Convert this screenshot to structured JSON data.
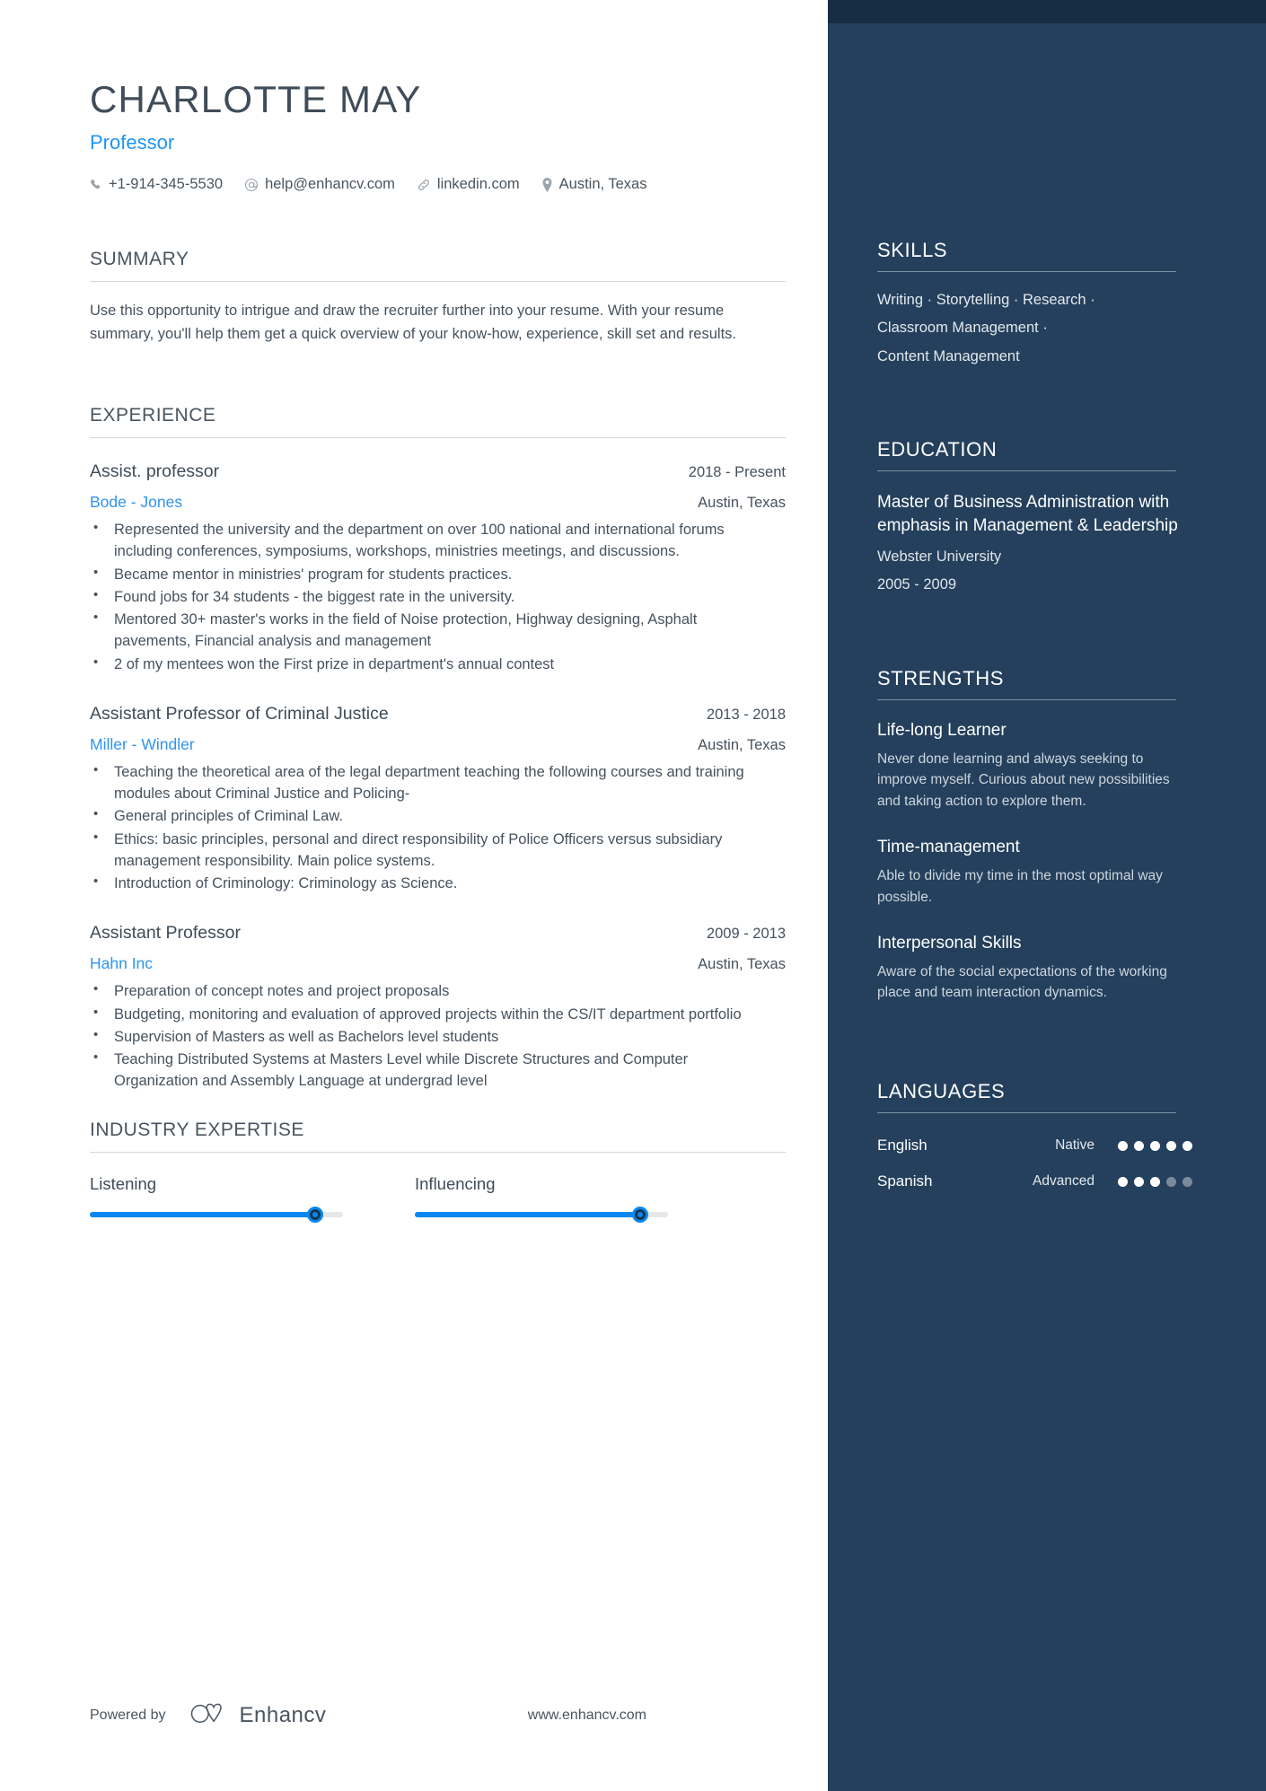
{
  "header": {
    "name": "CHARLOTTE MAY",
    "role": "Professor",
    "contacts": [
      {
        "icon": "phone-icon",
        "text": "+1-914-345-5530"
      },
      {
        "icon": "at-icon",
        "text": "help@enhancv.com"
      },
      {
        "icon": "link-icon",
        "text": "linkedin.com"
      },
      {
        "icon": "location-pin-icon",
        "text": "Austin, Texas"
      }
    ]
  },
  "summary": {
    "heading": "SUMMARY",
    "text": "Use this opportunity to intrigue and draw the recruiter further into your resume. With your resume summary, you'll help them get a quick overview of your know-how, experience, skill set and results."
  },
  "experience": {
    "heading": "EXPERIENCE",
    "jobs": [
      {
        "title": "Assist. professor",
        "dates": "2018 - Present",
        "company": "Bode - Jones",
        "location": "Austin, Texas",
        "bullets": [
          "Represented the university and the department on over 100 national and international forums including conferences, symposiums, workshops, ministries meetings, and discussions.",
          "Became mentor in ministries' program for students practices.",
          "Found jobs for 34 students - the biggest rate in the university.",
          "Mentored 30+ master's works in the field of Noise protection, Highway designing, Asphalt pavements, Financial analysis and management",
          "2 of my mentees won the First prize in department's annual contest"
        ]
      },
      {
        "title": "Assistant Professor of Criminal Justice",
        "dates": "2013 - 2018",
        "company": "Miller - Windler",
        "location": "Austin, Texas",
        "bullets": [
          "Teaching the theoretical area of the legal department teaching the following courses and training modules about Criminal Justice and Policing-",
          "General principles of Criminal Law.",
          "Ethics: basic principles, personal and direct responsibility of Police Officers versus subsidiary management responsibility. Main police systems.",
          "Introduction of Criminology: Criminology as Science."
        ]
      },
      {
        "title": "Assistant Professor",
        "dates": "2009 - 2013",
        "company": "Hahn Inc",
        "location": "Austin, Texas",
        "bullets": [
          " Preparation of concept notes and project proposals",
          " Budgeting, monitoring and evaluation of approved projects within the CS/IT department portfolio",
          "Supervision of Masters as well as Bachelors level students",
          "Teaching Distributed Systems at Masters Level while Discrete Structures and Computer Organization and Assembly Language at undergrad level"
        ]
      }
    ]
  },
  "industry_expertise": {
    "heading": "INDUSTRY EXPERTISE",
    "items": [
      {
        "label": "Listening",
        "value": 89
      },
      {
        "label": "Influencing",
        "value": 89
      }
    ]
  },
  "sidebar": {
    "skills": {
      "heading": "SKILLS",
      "lines": [
        "Writing · Storytelling · Research ·",
        "Classroom Management ·",
        "Content Management"
      ]
    },
    "education": {
      "heading": "EDUCATION",
      "degree": "Master of Business Administration with emphasis in Management & Leadership",
      "school": "Webster University",
      "dates": "2005 - 2009"
    },
    "strengths": {
      "heading": "STRENGTHS",
      "items": [
        {
          "title": "Life-long Learner",
          "desc": "Never done learning and always seeking to improve myself. Curious about new possibilities and taking action to explore them."
        },
        {
          "title": "Time-management",
          "desc": "Able to divide my time in the most optimal way possible."
        },
        {
          "title": "Interpersonal Skills",
          "desc": "Aware of the social expectations of the working place and team interaction dynamics."
        }
      ]
    },
    "languages": {
      "heading": "LANGUAGES",
      "items": [
        {
          "name": "English",
          "level": "Native",
          "filled": 5,
          "total": 5
        },
        {
          "name": "Spanish",
          "level": "Advanced",
          "filled": 3,
          "total": 5
        }
      ]
    }
  },
  "footer": {
    "powered_by": "Powered by",
    "brand": "Enhancv",
    "url": "www.enhancv.com"
  },
  "colors": {
    "sidebar_bg": "#24405c",
    "sidebar_top_strip": "#172d44",
    "accent_blue": "#1f94f2",
    "slider_blue": "#0b87ef",
    "text_dark": "#46525e"
  }
}
